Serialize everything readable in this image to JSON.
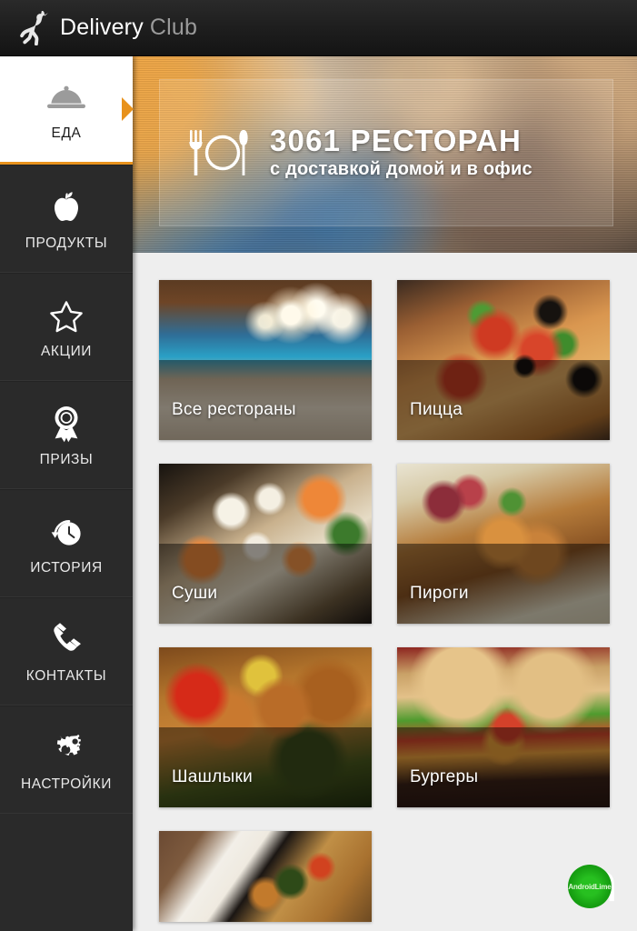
{
  "header": {
    "logo_icon": "ostrich-logo-icon",
    "brand_primary": "Delivery",
    "brand_secondary": "Club"
  },
  "sidebar": {
    "items": [
      {
        "label": "ЕДА",
        "icon": "cloche-icon",
        "active": true
      },
      {
        "label": "ПРОДУКТЫ",
        "icon": "apple-icon",
        "active": false
      },
      {
        "label": "АКЦИИ",
        "icon": "star-icon",
        "active": false
      },
      {
        "label": "ПРИЗЫ",
        "icon": "award-ribbon-icon",
        "active": false
      },
      {
        "label": "ИСТОРИЯ",
        "icon": "clock-history-icon",
        "active": false
      },
      {
        "label": "КОНТАКТЫ",
        "icon": "phone-icon",
        "active": false
      },
      {
        "label": "НАСТРОЙКИ",
        "icon": "gears-icon",
        "active": false
      }
    ],
    "accent_color": "#e8921c",
    "background_color": "#2a2a2a"
  },
  "banner": {
    "icon": "fork-plate-knife-icon",
    "title": "3061 РЕСТОРАН",
    "subtitle": "с доставкой домой и в офис"
  },
  "grid": {
    "tiles": [
      {
        "label": "Все рестораны",
        "image": "restaurant-interior-photo"
      },
      {
        "label": "Пицца",
        "image": "pizza-photo"
      },
      {
        "label": "Суши",
        "image": "sushi-photo"
      },
      {
        "label": "Пироги",
        "image": "pies-photo"
      },
      {
        "label": "Шашлыки",
        "image": "kebab-photo"
      },
      {
        "label": "Бургеры",
        "image": "burger-photo"
      },
      {
        "label": "",
        "image": "noodles-photo"
      }
    ]
  },
  "watermark": {
    "letter": "a",
    "label": "AndroidLime",
    "color": "#17a012"
  }
}
